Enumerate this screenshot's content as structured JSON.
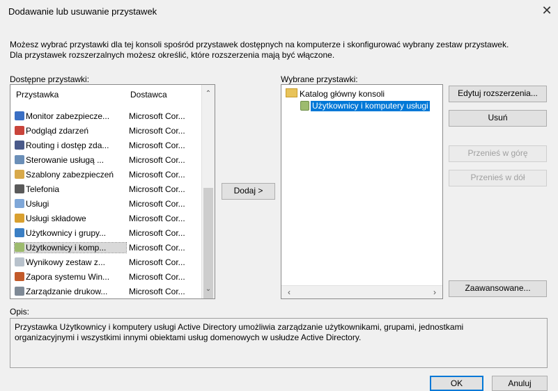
{
  "window": {
    "title": "Dodawanie lub usuwanie przystawek"
  },
  "intro": {
    "line1": "Możesz wybrać przystawki dla tej konsoli spośród przystawek dostępnych na komputerze i skonfigurować wybrany zestaw przystawek.",
    "line2": "Dla przystawek rozszerzalnych możesz określić, które rozszerzenia mają być włączone."
  },
  "available": {
    "label": "Dostępne przystawki:",
    "columns": [
      "Przystawka",
      "Dostawca"
    ],
    "rows": [
      {
        "name": "Monitor zabezpiecze...",
        "vendor": "Microsoft Cor...",
        "icon": "security-monitor-icon"
      },
      {
        "name": "Podgląd zdarzeń",
        "vendor": "Microsoft Cor...",
        "icon": "event-viewer-icon"
      },
      {
        "name": "Routing i dostęp zda...",
        "vendor": "Microsoft Cor...",
        "icon": "routing-icon"
      },
      {
        "name": "Sterowanie usługą ...",
        "vendor": "Microsoft Cor...",
        "icon": "service-control-icon"
      },
      {
        "name": "Szablony zabezpieczeń",
        "vendor": "Microsoft Cor...",
        "icon": "security-templates-icon"
      },
      {
        "name": "Telefonia",
        "vendor": "Microsoft Cor...",
        "icon": "telephony-icon"
      },
      {
        "name": "Usługi",
        "vendor": "Microsoft Cor...",
        "icon": "services-icon"
      },
      {
        "name": "Usługi składowe",
        "vendor": "Microsoft Cor...",
        "icon": "component-services-icon"
      },
      {
        "name": "Użytkownicy i grupy...",
        "vendor": "Microsoft Cor...",
        "icon": "users-groups-icon"
      },
      {
        "name": "Użytkownicy i komp...",
        "vendor": "Microsoft Cor...",
        "icon": "ad-users-computers-icon"
      },
      {
        "name": "Wynikowy zestaw z...",
        "vendor": "Microsoft Cor...",
        "icon": "rsop-icon"
      },
      {
        "name": "Zapora systemu Win...",
        "vendor": "Microsoft Cor...",
        "icon": "firewall-icon"
      },
      {
        "name": "Zarządzanie drukow...",
        "vendor": "Microsoft Cor...",
        "icon": "print-management-icon"
      }
    ]
  },
  "add_button": "Dodaj >",
  "selected": {
    "label": "Wybrane przystawki:",
    "root": "Katalog główny konsoli",
    "child": "Użytkownicy i komputery usługi"
  },
  "buttons": {
    "edit_extensions": "Edytuj rozszerzenia...",
    "remove": "Usuń",
    "move_up": "Przenieś w górę",
    "move_down": "Przenieś w dół",
    "advanced": "Zaawansowane...",
    "ok": "OK",
    "cancel": "Anuluj"
  },
  "description": {
    "label": "Opis:",
    "line1": "Przystawka Użytkownicy i komputery usługi Active Directory umożliwia zarządzanie użytkownikami, grupami, jednostkami",
    "line2": "organizacyjnymi i wszystkimi innymi obiektami usług domenowych w usłudze Active Directory."
  }
}
